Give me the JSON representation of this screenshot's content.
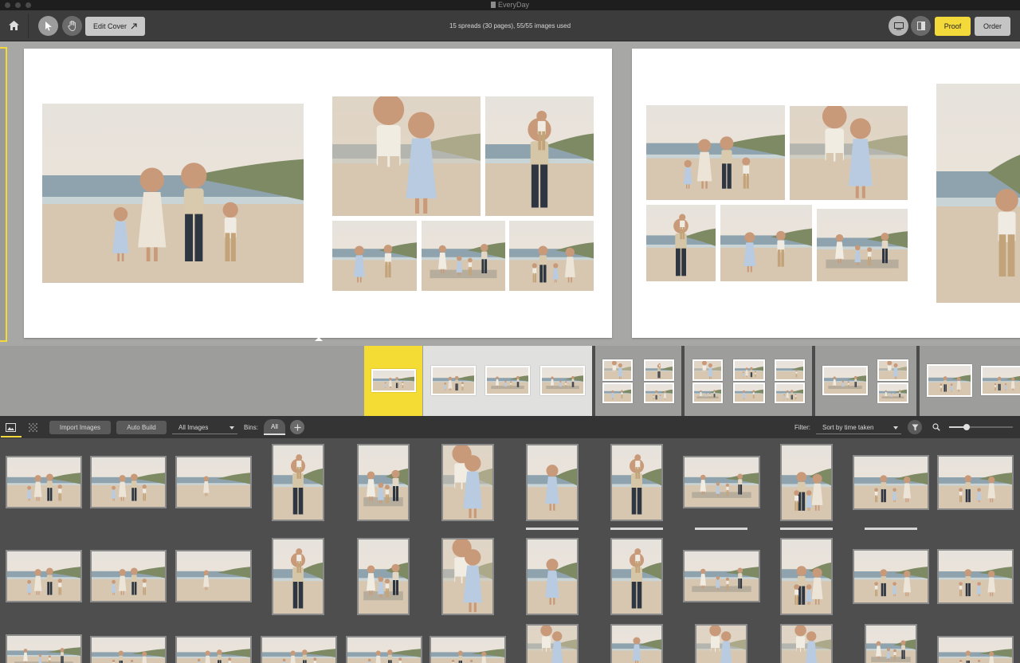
{
  "window": {
    "title": "EveryDay"
  },
  "toolbar": {
    "edit_cover_label": "Edit Cover",
    "status": "15 spreads (30 pages), 55/55 images used",
    "proof_label": "Proof",
    "order_label": "Order"
  },
  "library": {
    "import_label": "Import Images",
    "auto_build_label": "Auto Build",
    "source_selected": "All Images",
    "bins_label": "Bins:",
    "bin_selected": "All",
    "filter_label": "Filter:",
    "sort_selected": "Sort by time taken",
    "zoom_fraction": 0.27
  },
  "colors": {
    "accent": "#f4d93a",
    "toolbar": "#3c3c3c",
    "canvas": "#a7a7a5",
    "library": "#4e4e4e"
  },
  "icons": [
    "home-icon",
    "pointer-icon",
    "hand-icon",
    "arrow-out-icon",
    "single-page-icon",
    "spread-view-icon",
    "image-tab-icon",
    "layout-tab-icon",
    "plus-icon",
    "funnel-icon",
    "search-icon"
  ],
  "scenes": [
    "family-walk",
    "mother-daughter-hug",
    "father-son-shoulders",
    "kids-running",
    "family-sitting",
    "family-back-view",
    "boy-on-beach",
    "girl-on-beach",
    "mother-on-sand"
  ]
}
